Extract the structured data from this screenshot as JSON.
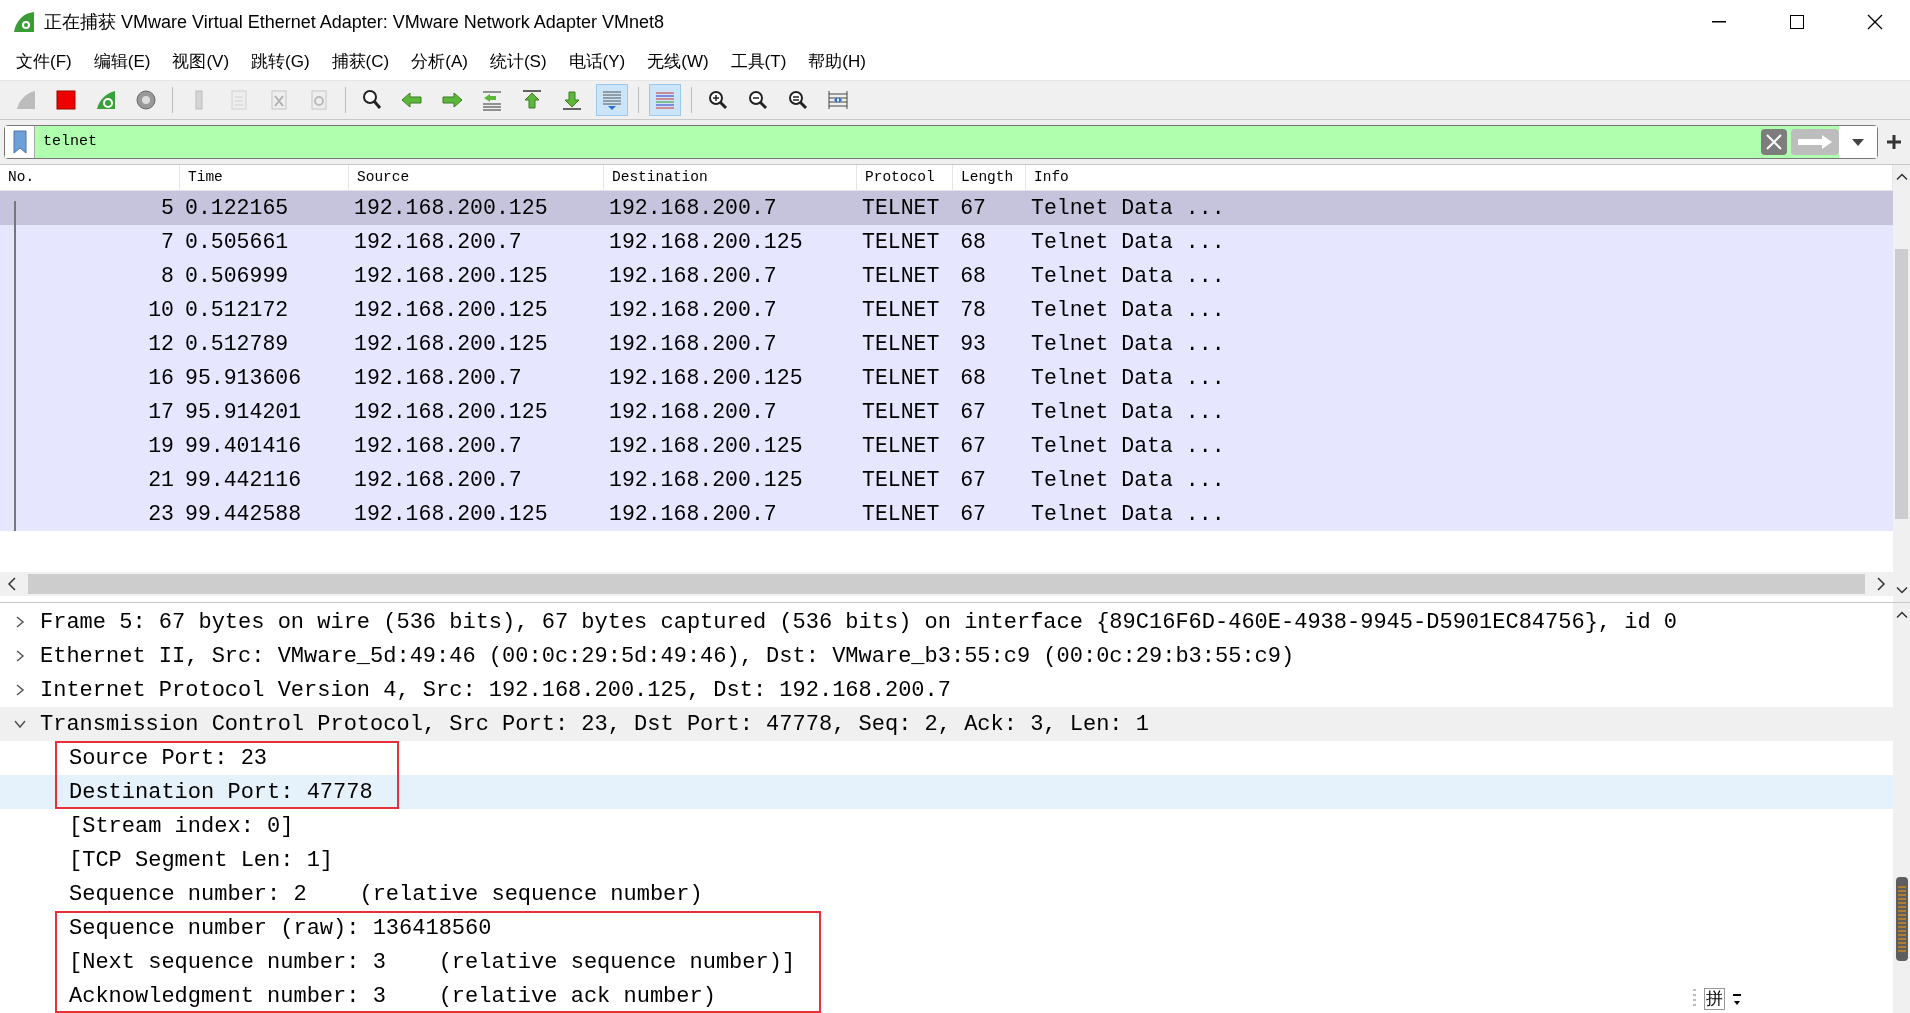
{
  "window": {
    "title": "正在捕获 VMware Virtual Ethernet Adapter: VMware Network Adapter VMnet8"
  },
  "menu": [
    "文件(F)",
    "编辑(E)",
    "视图(V)",
    "跳转(G)",
    "捕获(C)",
    "分析(A)",
    "统计(S)",
    "电话(Y)",
    "无线(W)",
    "工具(T)",
    "帮助(H)"
  ],
  "toolbar_groups": [
    [
      {
        "kind": "start",
        "disabled": true,
        "active": false
      },
      {
        "kind": "stop",
        "disabled": false,
        "active": false
      },
      {
        "kind": "restart",
        "disabled": false,
        "active": false
      },
      {
        "kind": "options",
        "disabled": false,
        "active": false
      }
    ],
    [
      {
        "kind": "open",
        "disabled": true,
        "active": false
      },
      {
        "kind": "save",
        "disabled": true,
        "active": false
      },
      {
        "kind": "close",
        "disabled": true,
        "active": false
      },
      {
        "kind": "reload",
        "disabled": true,
        "active": false
      }
    ],
    [
      {
        "kind": "find",
        "disabled": false,
        "active": false
      },
      {
        "kind": "back",
        "disabled": false,
        "active": false
      },
      {
        "kind": "forward",
        "disabled": false,
        "active": false
      },
      {
        "kind": "goto",
        "disabled": false,
        "active": false
      },
      {
        "kind": "first",
        "disabled": false,
        "active": false
      },
      {
        "kind": "last",
        "disabled": false,
        "active": false
      },
      {
        "kind": "autoscroll",
        "disabled": false,
        "active": true
      }
    ],
    [
      {
        "kind": "colorize",
        "disabled": false,
        "active": true
      }
    ],
    [
      {
        "kind": "zoom-in",
        "disabled": false,
        "active": false
      },
      {
        "kind": "zoom-out",
        "disabled": false,
        "active": false
      },
      {
        "kind": "zoom-normal",
        "disabled": false,
        "active": false
      },
      {
        "kind": "resize-columns",
        "disabled": false,
        "active": false
      }
    ]
  ],
  "filter": {
    "value": "telnet",
    "valid": true
  },
  "packet_list": {
    "columns": [
      "No.",
      "Time",
      "Source",
      "Destination",
      "Protocol",
      "Length",
      "Info"
    ],
    "rows": [
      {
        "no": "5",
        "time": "0.122165",
        "source": "192.168.200.125",
        "destination": "192.168.200.7",
        "protocol": "TELNET",
        "length": "67",
        "info": "Telnet Data ...",
        "selected": true
      },
      {
        "no": "7",
        "time": "0.505661",
        "source": "192.168.200.7",
        "destination": "192.168.200.125",
        "protocol": "TELNET",
        "length": "68",
        "info": "Telnet Data ...",
        "selected": false
      },
      {
        "no": "8",
        "time": "0.506999",
        "source": "192.168.200.125",
        "destination": "192.168.200.7",
        "protocol": "TELNET",
        "length": "68",
        "info": "Telnet Data ...",
        "selected": false
      },
      {
        "no": "10",
        "time": "0.512172",
        "source": "192.168.200.125",
        "destination": "192.168.200.7",
        "protocol": "TELNET",
        "length": "78",
        "info": "Telnet Data ...",
        "selected": false
      },
      {
        "no": "12",
        "time": "0.512789",
        "source": "192.168.200.125",
        "destination": "192.168.200.7",
        "protocol": "TELNET",
        "length": "93",
        "info": "Telnet Data ...",
        "selected": false
      },
      {
        "no": "16",
        "time": "95.913606",
        "source": "192.168.200.7",
        "destination": "192.168.200.125",
        "protocol": "TELNET",
        "length": "68",
        "info": "Telnet Data ...",
        "selected": false
      },
      {
        "no": "17",
        "time": "95.914201",
        "source": "192.168.200.125",
        "destination": "192.168.200.7",
        "protocol": "TELNET",
        "length": "67",
        "info": "Telnet Data ...",
        "selected": false
      },
      {
        "no": "19",
        "time": "99.401416",
        "source": "192.168.200.7",
        "destination": "192.168.200.125",
        "protocol": "TELNET",
        "length": "67",
        "info": "Telnet Data ...",
        "selected": false
      },
      {
        "no": "21",
        "time": "99.442116",
        "source": "192.168.200.7",
        "destination": "192.168.200.125",
        "protocol": "TELNET",
        "length": "67",
        "info": "Telnet Data ...",
        "selected": false
      },
      {
        "no": "23",
        "time": "99.442588",
        "source": "192.168.200.125",
        "destination": "192.168.200.7",
        "protocol": "TELNET",
        "length": "67",
        "info": "Telnet Data ...",
        "selected": false
      }
    ]
  },
  "packet_details": [
    {
      "text": "Frame 5: 67 bytes on wire (536 bits), 67 bytes captured (536 bits) on interface {89C16F6D-460E-4938-9945-D5901EC84756}, id 0",
      "expanded": false
    },
    {
      "text": "Ethernet II, Src: VMware_5d:49:46 (00:0c:29:5d:49:46), Dst: VMware_b3:55:c9 (00:0c:29:b3:55:c9)",
      "expanded": false
    },
    {
      "text": "Internet Protocol Version 4, Src: 192.168.200.125, Dst: 192.168.200.7",
      "expanded": false
    },
    {
      "text": "Transmission Control Protocol, Src Port: 23, Dst Port: 47778, Seq: 2, Ack: 3, Len: 1",
      "expanded": true,
      "children": [
        {
          "text": "Source Port: 23",
          "selected": false,
          "boxed": true
        },
        {
          "text": "Destination Port: 47778",
          "selected": true,
          "boxed": true
        },
        {
          "text": "[Stream index: 0]",
          "selected": false,
          "boxed": false
        },
        {
          "text": "[TCP Segment Len: 1]",
          "selected": false,
          "boxed": false
        },
        {
          "text": "Sequence number: 2    (relative sequence number)",
          "selected": false,
          "boxed": false
        },
        {
          "text": "Sequence number (raw): 136418560",
          "selected": false,
          "boxed": true
        },
        {
          "text": "[Next sequence number: 3    (relative sequence number)]",
          "selected": false,
          "boxed": true
        },
        {
          "text": "Acknowledgment number: 3    (relative ack number)",
          "selected": false,
          "boxed": true
        }
      ]
    }
  ],
  "ime_indicator": "拼"
}
